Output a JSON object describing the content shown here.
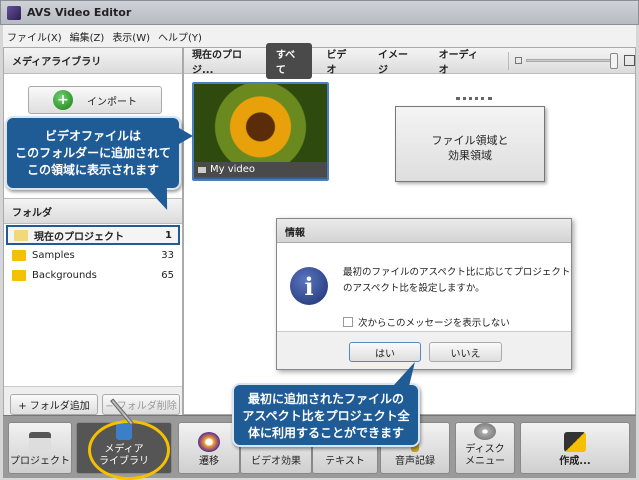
{
  "window": {
    "title": "AVS Video Editor"
  },
  "menu": [
    "ファイル(X)",
    "編集(Z)",
    "表示(W)",
    "ヘルプ(Y)"
  ],
  "left": {
    "header": "メディアライブラリ",
    "import_label": "インポート",
    "folder_header": "フォルダ",
    "folders": [
      {
        "name": "現在のプロジェクト",
        "count": "1"
      },
      {
        "name": "Samples",
        "count": "33"
      },
      {
        "name": "Backgrounds",
        "count": "65"
      }
    ],
    "add_folder": "+ フォルダ追加",
    "delete_folder": "− フォルダ削除"
  },
  "right": {
    "current": "現在のプロジ...",
    "tabs": [
      "すべて",
      "ビデオ",
      "イメージ",
      "オーディオ"
    ],
    "thumb_label": "My video",
    "note_lines": [
      "ファイル領域と",
      "効果領域"
    ],
    "zoom_level": 1.0
  },
  "callouts": {
    "top": [
      "ビデオファイルは",
      "このフォルダーに追加されて",
      "この領域に表示されます"
    ],
    "bottom": [
      "最初に追加されたファイルの",
      "アスペクト比をプロジェクト全",
      "体に利用することができます"
    ]
  },
  "dialog": {
    "title": "情報",
    "message_lines": [
      "最初のファイルのアスペクト比に応じてプロジェクト",
      "のアスペクト比を設定しますか。"
    ],
    "checkbox_label": "次からこのメッセージを表示しない",
    "checked": false,
    "yes": "はい",
    "no": "いいえ"
  },
  "toolbar": [
    {
      "label": "プロジェクト"
    },
    {
      "label": "メディア\nライブラリ"
    },
    {
      "label": "遷移"
    },
    {
      "label": "ビデオ効果"
    },
    {
      "label": "テキスト"
    },
    {
      "label": "音声記録"
    },
    {
      "label": "ディスク\nメニュー"
    },
    {
      "label": "作成..."
    }
  ],
  "colors": {
    "callout": "#1f5b95",
    "highlight_ring": "#f5c000",
    "active_tab": "#4a4a4a"
  }
}
